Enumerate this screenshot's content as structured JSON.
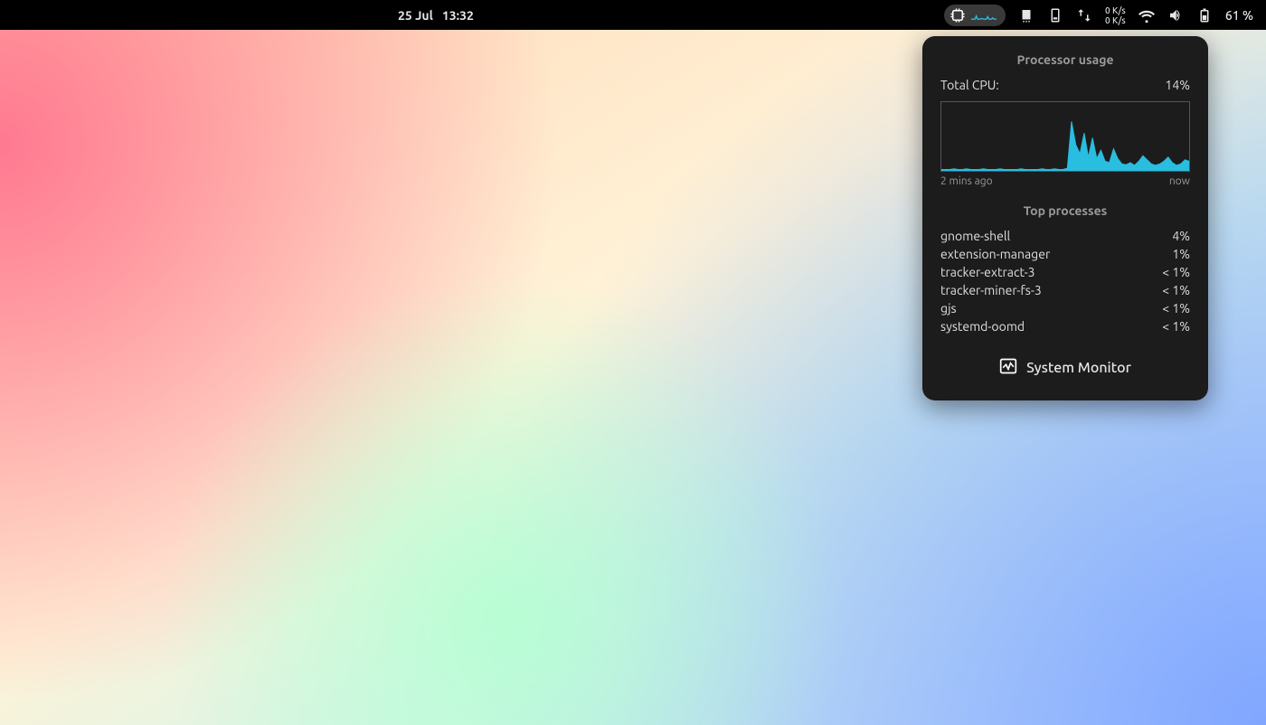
{
  "topbar": {
    "date": "25 Jul",
    "time": "13:32",
    "net_up": "0 K/s",
    "net_down": "0 K/s",
    "battery_text": "61 %"
  },
  "popup": {
    "header": "Processor usage",
    "total_label": "Total CPU:",
    "total_value": "14%",
    "time_start": "2 mins ago",
    "time_end": "now",
    "top_header": "Top processes",
    "processes": [
      {
        "name": "gnome-shell",
        "pct": "4%"
      },
      {
        "name": "extension-manager",
        "pct": "1%"
      },
      {
        "name": "tracker-extract-3",
        "pct": "< 1%"
      },
      {
        "name": "tracker-miner-fs-3",
        "pct": "< 1%"
      },
      {
        "name": "gjs",
        "pct": "< 1%"
      },
      {
        "name": "systemd-oomd",
        "pct": "< 1%"
      }
    ],
    "button_label": "System Monitor"
  },
  "colors": {
    "chart": "#29bde0"
  },
  "chart_data": {
    "type": "area",
    "title": "Processor usage",
    "xlabel": "",
    "ylabel": "",
    "x_start": "2 mins ago",
    "x_end": "now",
    "ylim": [
      0,
      100
    ],
    "series": [
      {
        "name": "Total CPU %",
        "values": [
          2,
          2,
          2,
          3,
          2,
          2,
          3,
          2,
          2,
          2,
          3,
          2,
          2,
          2,
          3,
          2,
          2,
          2,
          2,
          3,
          2,
          2,
          2,
          2,
          3,
          2,
          2,
          3,
          2,
          2,
          4,
          72,
          38,
          25,
          55,
          20,
          48,
          18,
          30,
          14,
          12,
          32,
          18,
          10,
          9,
          12,
          8,
          14,
          22,
          16,
          10,
          8,
          10,
          14,
          20,
          12,
          8,
          10,
          16,
          14
        ]
      }
    ]
  }
}
